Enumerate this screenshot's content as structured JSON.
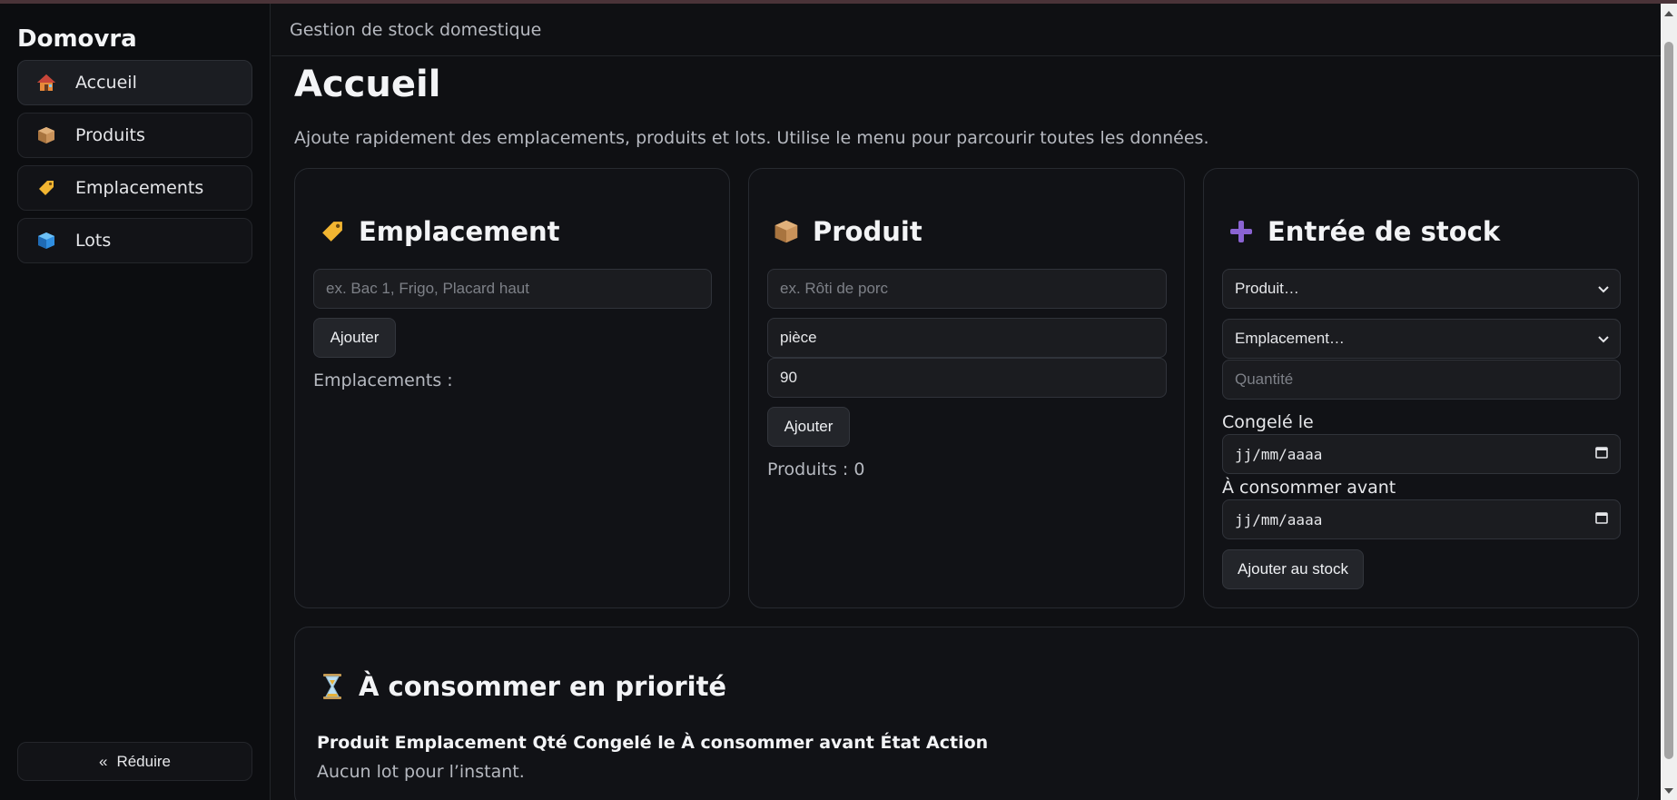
{
  "app": {
    "brand": "Domovra",
    "header_subtitle": "Gestion de stock domestique"
  },
  "sidebar": {
    "items": [
      {
        "label": "Accueil",
        "icon": "house-icon",
        "active": true
      },
      {
        "label": "Produits",
        "icon": "package-icon",
        "active": false
      },
      {
        "label": "Emplacements",
        "icon": "label-tag-icon",
        "active": false
      },
      {
        "label": "Lots",
        "icon": "cube-icon",
        "active": false
      }
    ],
    "collapse_chevron": "«",
    "collapse_label": "Réduire"
  },
  "main": {
    "title": "Accueil",
    "description": "Ajoute rapidement des emplacements, produits et lots. Utilise le menu pour parcourir toutes les données."
  },
  "emplacement_card": {
    "title": "Emplacement",
    "icon": "label-tag-icon",
    "name_placeholder": "ex. Bac 1, Frigo, Placard haut",
    "add_label": "Ajouter",
    "list_label": "Emplacements :"
  },
  "produit_card": {
    "title": "Produit",
    "icon": "package-icon",
    "name_placeholder": "ex. Rôti de porc",
    "unit_value": "pièce",
    "duration_value": "90",
    "add_label": "Ajouter",
    "count_label": "Produits : 0"
  },
  "stock_card": {
    "title": "Entrée de stock",
    "icon": "plus-icon",
    "product_select": "Produit…",
    "location_select": "Emplacement…",
    "quantity_placeholder": "Quantité",
    "frozen_label": "Congelé le",
    "frozen_value": "jj/mm/aaaa",
    "best_before_label": "À consommer avant",
    "best_before_value": "jj/mm/aaaa",
    "submit_label": "Ajouter au stock"
  },
  "priority_card": {
    "title": "À consommer en priorité",
    "icon": "hourglass-icon",
    "columns_text": "Produit Emplacement Qté Congelé le À consommer avant État Action",
    "empty_text": "Aucun lot pour l’instant."
  },
  "colors": {
    "background": "#0f1013",
    "card": "#111216",
    "accent_purple": "#8a63d2"
  }
}
